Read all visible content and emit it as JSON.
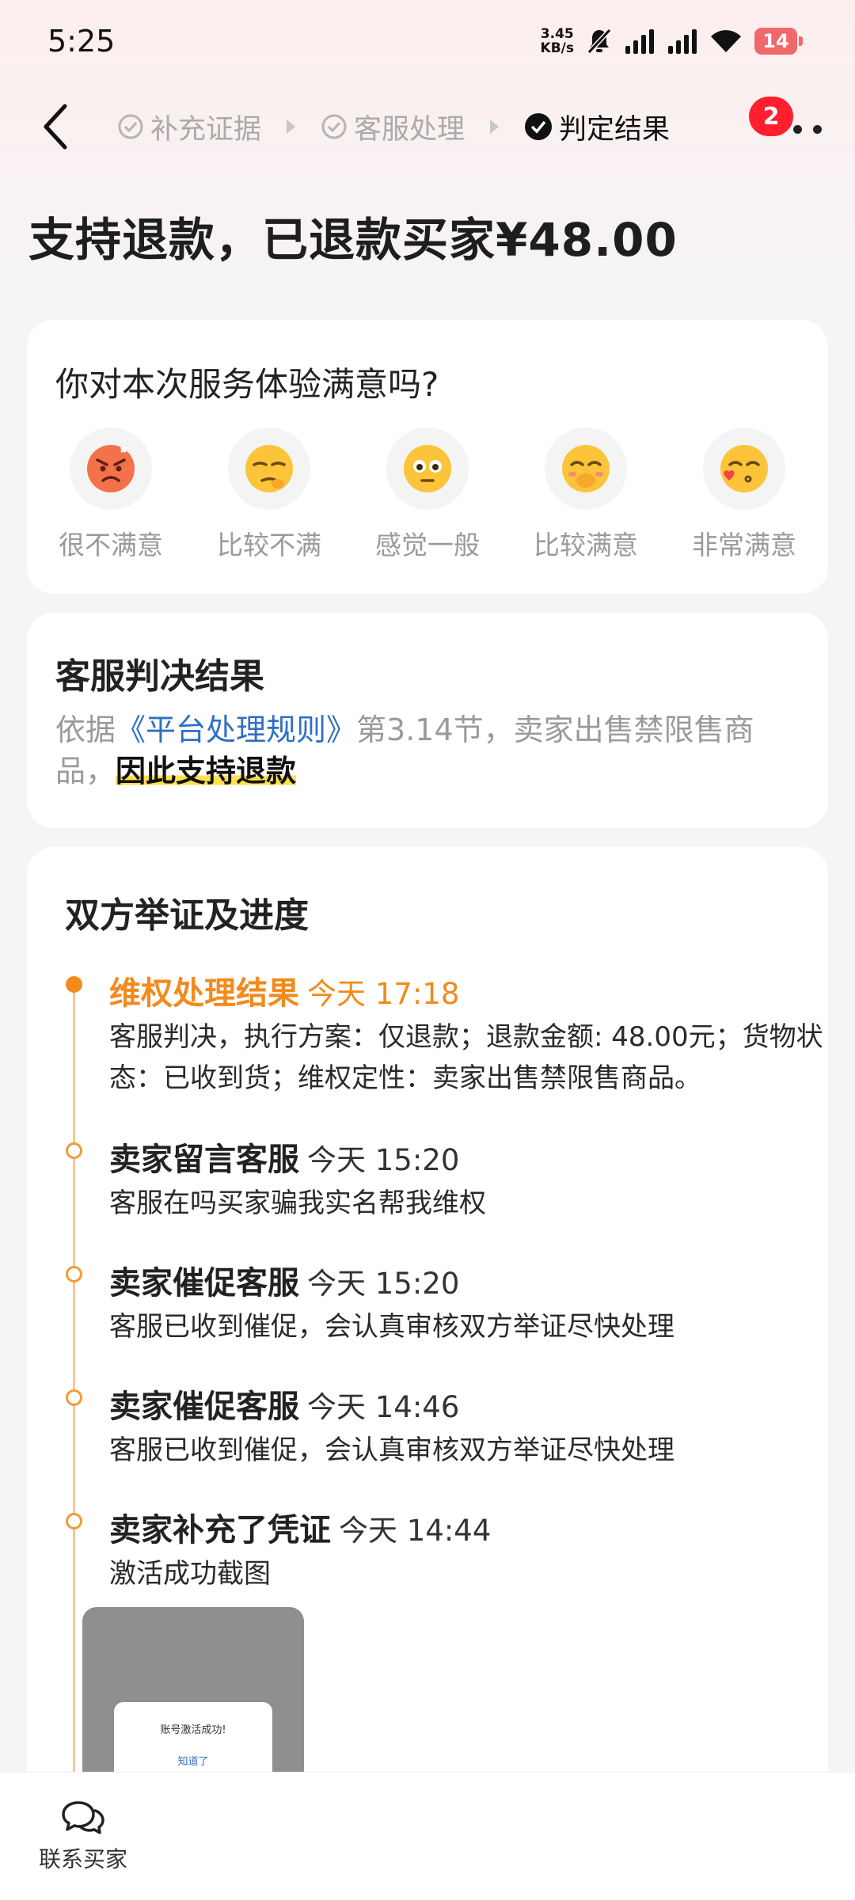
{
  "status_bar": {
    "time": "5:25",
    "net_speed_value": "3.45",
    "net_speed_unit": "KB/s",
    "battery_level": "14",
    "icons": [
      "mute-icon",
      "signal-icon",
      "signal-icon",
      "wifi-icon",
      "battery-icon"
    ]
  },
  "header": {
    "back_icon": "chevron-left-icon",
    "steps": [
      {
        "label": "补充证据",
        "state": "done"
      },
      {
        "label": "客服处理",
        "state": "done"
      },
      {
        "label": "判定结果",
        "state": "current"
      }
    ],
    "more_icon": "more-dots-icon",
    "more_badge": "2"
  },
  "result_title": "支持退款，已退款买家¥48.00",
  "satisfaction": {
    "question": "你对本次服务体验满意吗?",
    "options": [
      {
        "label": "很不满意",
        "icon": "angry-face-icon"
      },
      {
        "label": "比较不满",
        "icon": "unamused-face-icon"
      },
      {
        "label": "感觉一般",
        "icon": "neutral-face-icon"
      },
      {
        "label": "比较满意",
        "icon": "blushing-face-icon"
      },
      {
        "label": "非常满意",
        "icon": "kissing-heart-face-icon"
      }
    ]
  },
  "verdict": {
    "title": "客服判决结果",
    "prefix": "依据",
    "rule_link": "《平台处理规则》",
    "middle": "第3.14节，卖家出售禁限售商品，",
    "emphasis": "因此支持退款"
  },
  "timeline": {
    "title": "双方举证及进度",
    "items": [
      {
        "event": "维权处理结果",
        "time": "今天 17:18",
        "desc": "客服判决，执行方案：仅退款；退款金额: 48.00元；货物状态：已收到货；维权定性：卖家出售禁限售商品。",
        "active": true
      },
      {
        "event": "卖家留言客服",
        "time": "今天 15:20",
        "desc": "客服在吗买家骗我实名帮我维权",
        "active": false
      },
      {
        "event": "卖家催促客服",
        "time": "今天 15:20",
        "desc": "客服已收到催促，会认真审核双方举证尽快处理",
        "active": false
      },
      {
        "event": "卖家催促客服",
        "time": "今天 14:46",
        "desc": "客服已收到催促，会认真审核双方举证尽快处理",
        "active": false
      },
      {
        "event": "卖家补充了凭证",
        "time": "今天 14:44",
        "desc": "激活成功截图",
        "active": false
      }
    ],
    "evidence": {
      "dialog_text": "账号激活成功!",
      "dialog_button": "知道了"
    }
  },
  "bottom_bar": {
    "contact_label": "联系买家",
    "contact_icon": "chat-bubbles-icon"
  },
  "colors": {
    "accent_orange": "#f28a1c",
    "link_blue": "#2f6fc4",
    "badge_red": "#ff1f2e",
    "highlight_yellow": "#ffe24b"
  }
}
